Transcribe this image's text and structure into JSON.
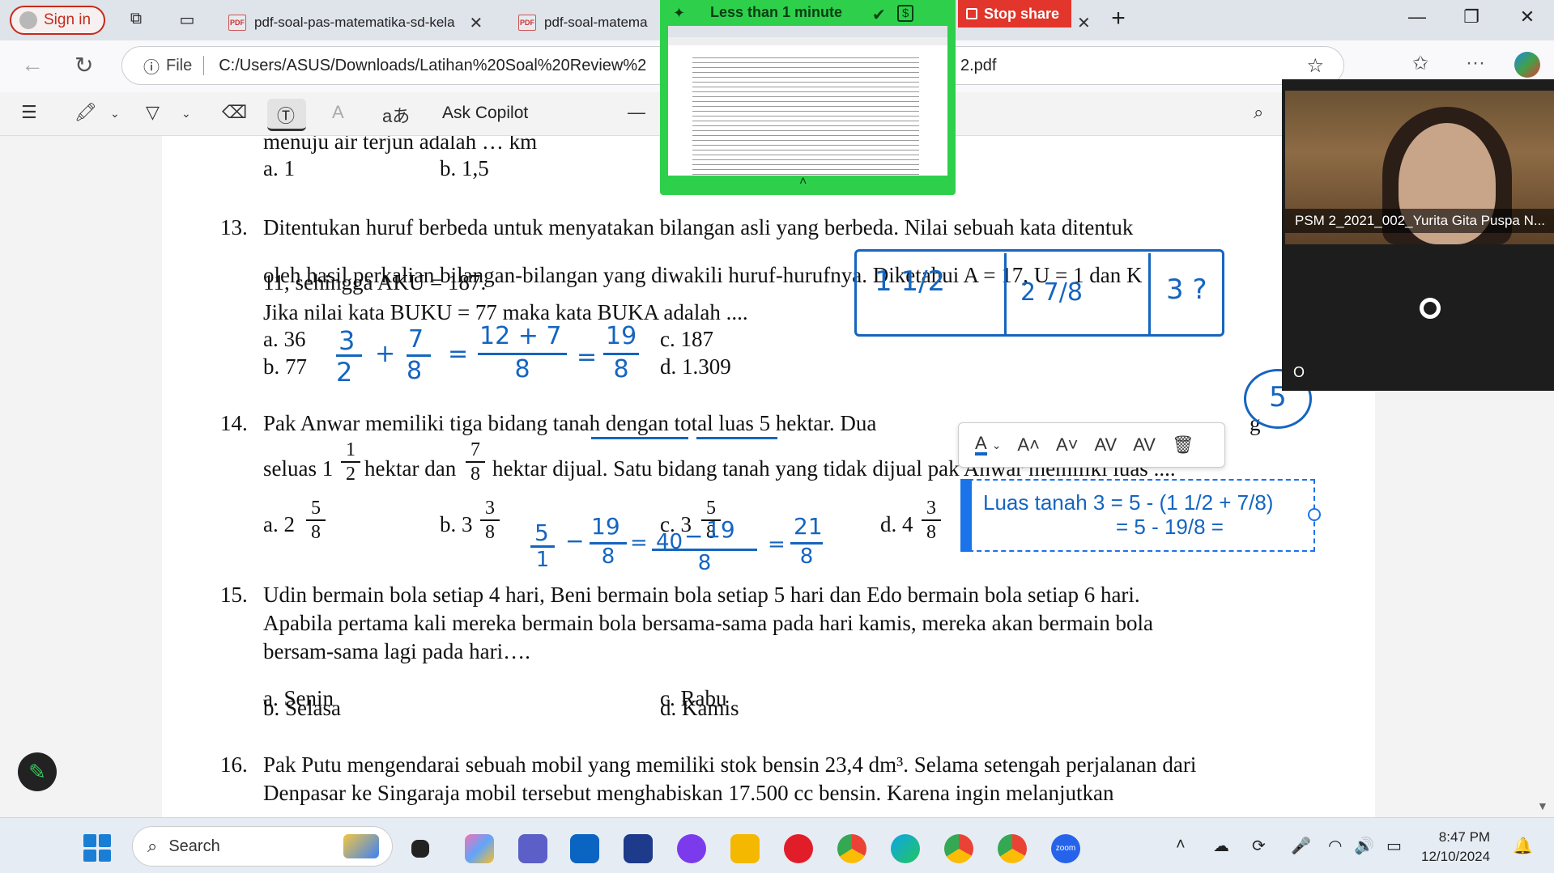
{
  "browser": {
    "sign_in": "Sign in",
    "tabs": [
      {
        "title": "pdf-soal-pas-matematika-sd-kela"
      },
      {
        "title": "pdf-soal-matema"
      }
    ],
    "address": {
      "prefix": "File",
      "url": "C:/Users/ASUS/Downloads/Latihan%20Soal%20Review%2",
      "url_tail": "2.pdf"
    },
    "pdf_toolbar": {
      "ask_copilot": "Ask Copilot",
      "read_aloud_glyph": "A",
      "translate_glyph": "aあ"
    }
  },
  "share": {
    "timer": "Less than 1 minute",
    "stop_label": "Stop share",
    "dollar": "$"
  },
  "video": {
    "participant": "PSM 2_2021_002_Yurita Gita Puspa N...",
    "initial": "O"
  },
  "document": {
    "prev": {
      "partial": "menuju air terjun adalah … km",
      "a": "a. 1",
      "b": "b. 1,5"
    },
    "q13": {
      "num": "13.",
      "line1": "Ditentukan huruf berbeda untuk menyatakan bilangan asli yang berbeda. Nilai sebuah kata ditentuk",
      "line2": "oleh hasil perkalian bilangan-bilangan yang diwakili huruf-hurufnya. Diketahui A = 17, U = 1 dan K",
      "line2_overlap": "11, sehingga AKU = 187.",
      "line3": "Jika nilai kata BUKU = 77 maka kata BUKA adalah ....",
      "a": "a. 36",
      "b": "b. 77",
      "c": "c. 187",
      "d": "d. 1.309"
    },
    "q14": {
      "num": "14.",
      "line1": "Pak Anwar memiliki tiga bidang tanah dengan total luas 5 hektar. Dua",
      "line1_tail": "g",
      "line2_a": "seluas 1",
      "line2_b": "hektar dan",
      "line2_c": "hektar dijual. Satu bidang tanah yang tidak dijual pak Anwar memiliki luas ....",
      "f1": {
        "n": "1",
        "d": "2"
      },
      "f2": {
        "n": "7",
        "d": "8"
      },
      "a": {
        "w": "a. 2",
        "n": "5",
        "d": "8"
      },
      "b": {
        "w": "b. 3",
        "n": "3",
        "d": "8"
      },
      "c": {
        "w": "c. 3",
        "n": "5",
        "d": "8"
      },
      "d": {
        "w": "d. 4",
        "n": "3",
        "d": "8"
      }
    },
    "q15": {
      "num": "15.",
      "line1": "Udin bermain bola setiap 4 hari, Beni bermain bola setiap 5 hari dan Edo bermain bola setiap 6 hari.",
      "line2": "Apabila pertama kali mereka bermain bola bersama-sama pada hari kamis, mereka akan bermain bola",
      "line3": "bersam-sama lagi pada hari….",
      "a": "a. Senin",
      "b": "b. Selasa",
      "c": "c. Rabu",
      "d": "d. Kamis"
    },
    "q16": {
      "num": "16.",
      "line1": "Pak Putu mengendarai sebuah mobil yang memiliki stok bensin 23,4 dm³. Selama setengah perjalanan dari",
      "line2": "Denpasar ke Singaraja mobil tersebut menghabiskan 17.500 cc bensin. Karena ingin melanjutkan"
    }
  },
  "ink": {
    "q13_work": [
      "3",
      "+",
      "7",
      "=",
      "12 + 7",
      "=",
      "19",
      "2",
      "8",
      "8",
      "8"
    ],
    "box_cells": [
      "1 1/2",
      "2 7/8",
      "3 ?"
    ],
    "circle": "5",
    "q14_work": [
      "5",
      "−",
      "19",
      "=",
      "40",
      "−",
      "19",
      "=",
      "21",
      "1",
      "8",
      "8",
      "8"
    ]
  },
  "textbox": {
    "line1": "Luas tanah 3 = 5 - (1 1/2 + 7/8)",
    "line2": "= 5 - 19/8 = "
  },
  "taskbar": {
    "search": "Search",
    "time": "8:47 PM",
    "date": "12/10/2024",
    "zoom_label": "zoom"
  }
}
